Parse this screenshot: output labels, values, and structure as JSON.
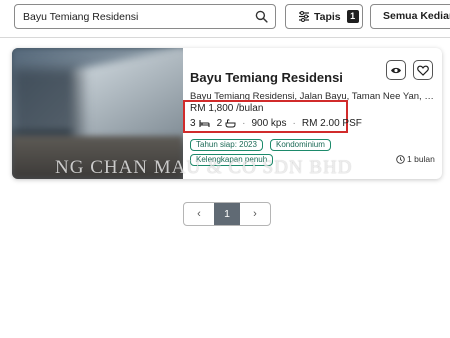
{
  "search": {
    "value": "Bayu Temiang Residensi"
  },
  "toolbar": {
    "filter_label": "Tapis",
    "filter_count": "1",
    "sort_label": "Semua Kediaman"
  },
  "listing": {
    "title": "Bayu Temiang Residensi",
    "address": "Bayu Temiang Residensi, Jalan Bayu, Taman Nee Yan, Seremban",
    "price": "RM 1,800 /bulan",
    "bedrooms": "3",
    "bathrooms": "2",
    "size": "900 kps",
    "psf": "RM 2.00 PSF",
    "tags": [
      "Tahun siap: 2023",
      "Kondominium",
      "Kelengkapan penuh"
    ],
    "posted": "1 bulan",
    "watermark": "NG CHAN MAU & CO SDN BHD"
  },
  "pagination": {
    "prev": "‹",
    "current": "1",
    "next": "›"
  },
  "colors": {
    "highlight": "#d12b2b",
    "tag_border": "#1d8a6b",
    "active_page": "#606a74"
  }
}
